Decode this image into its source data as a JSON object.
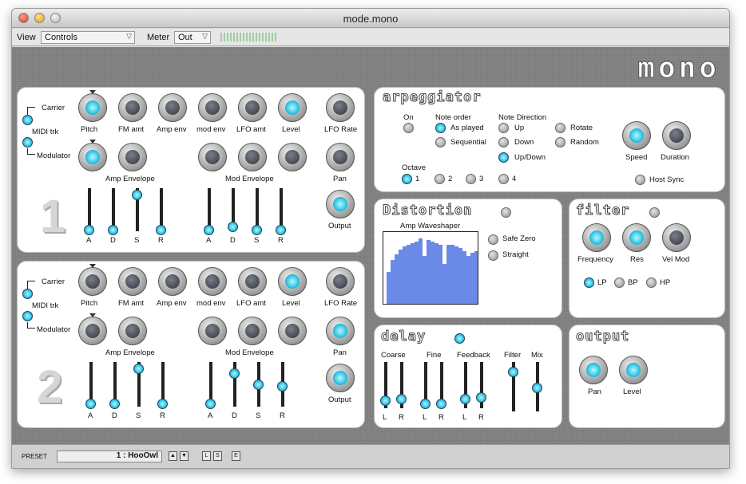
{
  "window": {
    "title": "mode.mono"
  },
  "toolbar": {
    "view_label": "View",
    "view_value": "Controls",
    "meter_label": "Meter",
    "meter_value": "Out"
  },
  "logo": "mono",
  "voice1": {
    "number": "1",
    "carrier": "Carrier",
    "midi_trk": "MIDI trk",
    "modulator": "Modulator",
    "knobs_top": [
      "Pitch",
      "FM amt",
      "Amp env",
      "mod env",
      "LFO amt",
      "Level",
      "LFO Rate"
    ],
    "pan": "Pan",
    "output": "Output",
    "amp_env": "Amp Envelope",
    "mod_env": "Mod Envelope",
    "adsr": [
      "A",
      "D",
      "S",
      "R"
    ]
  },
  "voice2": {
    "number": "2",
    "carrier": "Carrier",
    "midi_trk": "MIDI trk",
    "modulator": "Modulator",
    "knobs_top": [
      "Pitch",
      "FM amt",
      "Amp env",
      "mod env",
      "LFO amt",
      "Level",
      "LFO Rate"
    ],
    "pan": "Pan",
    "output": "Output",
    "amp_env": "Amp Envelope",
    "mod_env": "Mod Envelope",
    "adsr": [
      "A",
      "D",
      "S",
      "R"
    ]
  },
  "arp": {
    "title": "arpeggiator",
    "on": "On",
    "note_order": "Note order",
    "order_opts": [
      "As played",
      "Sequential"
    ],
    "note_dir": "Note Direction",
    "dir_opts": [
      "Up",
      "Down",
      "Up/Down"
    ],
    "dir_opts2": [
      "Rotate",
      "Random"
    ],
    "speed": "Speed",
    "duration": "Duration",
    "octave": "Octave",
    "octave_opts": [
      "1",
      "2",
      "3",
      "4"
    ],
    "host_sync": "Host Sync"
  },
  "distortion": {
    "title": "Distortion",
    "waveshaper": "Amp Waveshaper",
    "safe_zero": "Safe Zero",
    "straight": "Straight"
  },
  "filter": {
    "title": "filter",
    "frequency": "Frequency",
    "res": "Res",
    "vel_mod": "Vel Mod",
    "types": [
      "LP",
      "BP",
      "HP"
    ]
  },
  "delay": {
    "title": "delay",
    "coarse": "Coarse",
    "fine": "Fine",
    "feedback": "Feedback",
    "filter": "Filter",
    "mix": "Mix",
    "lr": [
      "L",
      "R"
    ]
  },
  "output": {
    "title": "output",
    "pan": "Pan",
    "level": "Level"
  },
  "footer": {
    "preset_label": "PRESET",
    "preset_value": "1 : HooOwl",
    "btn_up": "▲",
    "btn_down": "▼",
    "btn_l": "L",
    "btn_s": "S",
    "btn_e": "E"
  }
}
